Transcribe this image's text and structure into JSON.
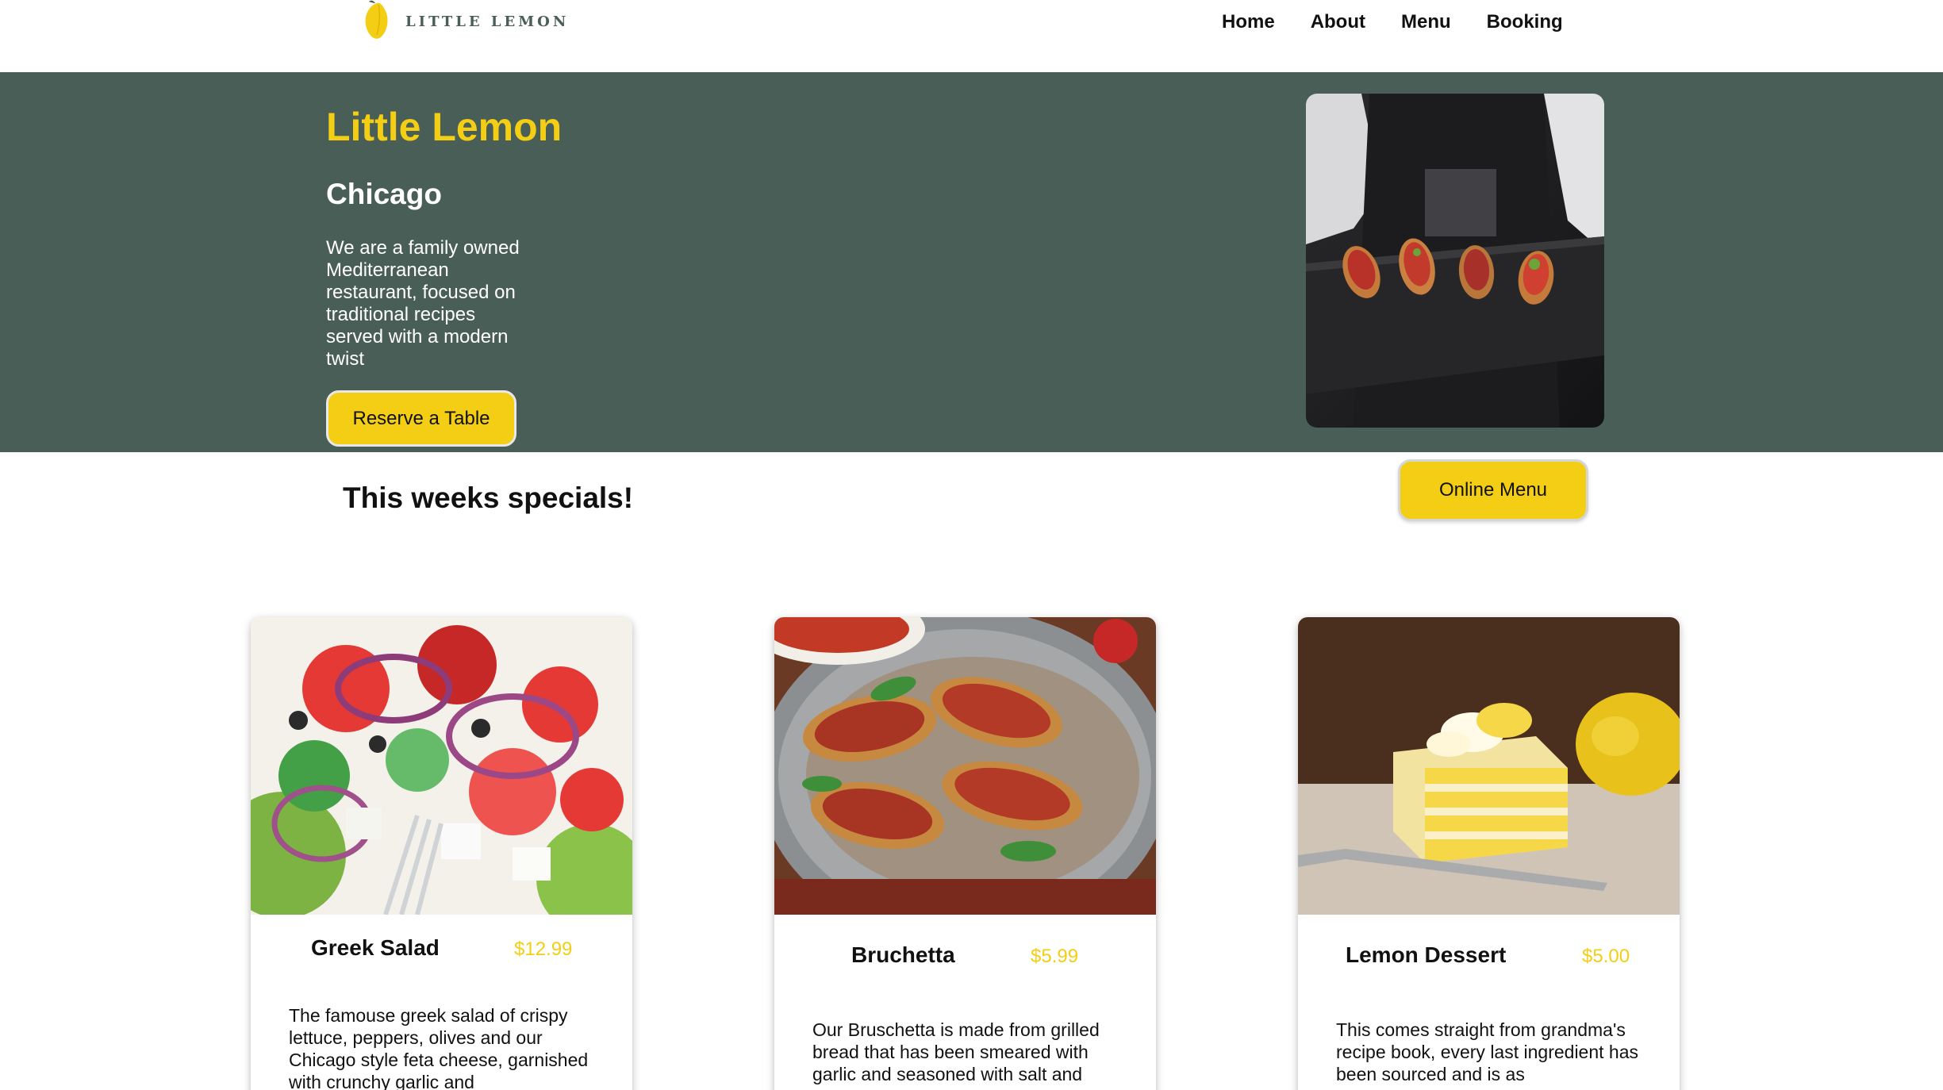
{
  "header": {
    "logo_text": "LITTLE LEMON",
    "nav": [
      "Home",
      "About",
      "Menu",
      "Booking"
    ]
  },
  "hero": {
    "title": "Little Lemon",
    "subtitle": "Chicago",
    "description": "We are a family owned Mediterranean restaurant, focused on traditional recipes served with a modern twist",
    "cta": "Reserve a Table"
  },
  "specials": {
    "title": "This weeks specials!",
    "menu_button": "Online Menu",
    "cards": [
      {
        "name": "Greek Salad",
        "price": "$12.99",
        "description": "The famouse greek salad of crispy lettuce, peppers, olives and our Chicago style feta cheese, garnished with crunchy garlic and"
      },
      {
        "name": "Bruchetta",
        "price": "$5.99",
        "description": "Our Bruschetta is made from grilled bread that has been smeared with garlic and seasoned with salt and"
      },
      {
        "name": "Lemon Dessert",
        "price": "$5.00",
        "description": "This comes straight from grandma's recipe book, every last ingredient has been sourced and is as"
      }
    ]
  },
  "colors": {
    "primary_green": "#495e57",
    "primary_yellow": "#f4ce14"
  }
}
